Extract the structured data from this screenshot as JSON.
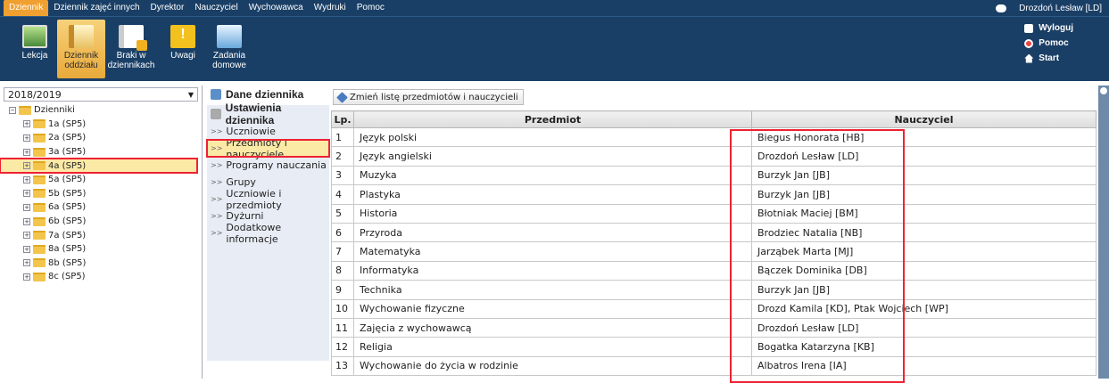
{
  "menu": [
    "Dziennik",
    "Dziennik zajęć innych",
    "Dyrektor",
    "Nauczyciel",
    "Wychowawca",
    "Wydruki",
    "Pomoc"
  ],
  "user": "Drozdoń Lesław [LD]",
  "toolbar": {
    "lekcja": "Lekcja",
    "dziennik": "Dziennik oddziału",
    "braki": "Braki w dziennikach",
    "uwagi": "Uwagi",
    "zadania": "Zadania domowe"
  },
  "links": {
    "logout": "Wyloguj",
    "help": "Pomoc",
    "start": "Start"
  },
  "year": "2018/2019",
  "tree_root": "Dzienniki",
  "classes": [
    "1a (SP5)",
    "2a (SP5)",
    "3a (SP5)",
    "4a (SP5)",
    "5a (SP5)",
    "5b (SP5)",
    "6a (SP5)",
    "6b (SP5)",
    "7a (SP5)",
    "8a (SP5)",
    "8b (SP5)",
    "8c (SP5)"
  ],
  "selected_class": "4a (SP5)",
  "nav": {
    "dane": "Dane dziennika",
    "ustawienia": "Ustawienia dziennika",
    "items": [
      "Uczniowie",
      "Przedmioty i nauczyciele",
      "Programy nauczania",
      "Grupy",
      "Uczniowie i przedmioty",
      "Dyżurni",
      "Dodatkowe informacje"
    ],
    "selected": "Przedmioty i nauczyciele"
  },
  "change_button": "Zmień listę przedmiotów i nauczycieli",
  "table": {
    "headers": [
      "Lp.",
      "Przedmiot",
      "Nauczyciel"
    ],
    "rows": [
      [
        "1",
        "Język polski",
        "Biegus Honorata [HB]"
      ],
      [
        "2",
        "Język angielski",
        "Drozdoń Lesław [LD]"
      ],
      [
        "3",
        "Muzyka",
        "Burzyk Jan [JB]"
      ],
      [
        "4",
        "Plastyka",
        "Burzyk Jan [JB]"
      ],
      [
        "5",
        "Historia",
        "Błotniak Maciej [BM]"
      ],
      [
        "6",
        "Przyroda",
        "Brodziec Natalia [NB]"
      ],
      [
        "7",
        "Matematyka",
        "Jarząbek Marta [MJ]"
      ],
      [
        "8",
        "Informatyka",
        "Bączek Dominika [DB]"
      ],
      [
        "9",
        "Technika",
        "Burzyk Jan [JB]"
      ],
      [
        "10",
        "Wychowanie fizyczne",
        "Drozd Kamila [KD], Ptak Wojciech [WP]"
      ],
      [
        "11",
        "Zajęcia z wychowawcą",
        "Drozdoń Lesław [LD]"
      ],
      [
        "12",
        "Religia",
        "Bogatka Katarzyna [KB]"
      ],
      [
        "13",
        "Wychowanie do życia w rodzinie",
        "Albatros Irena [IA]"
      ]
    ]
  }
}
